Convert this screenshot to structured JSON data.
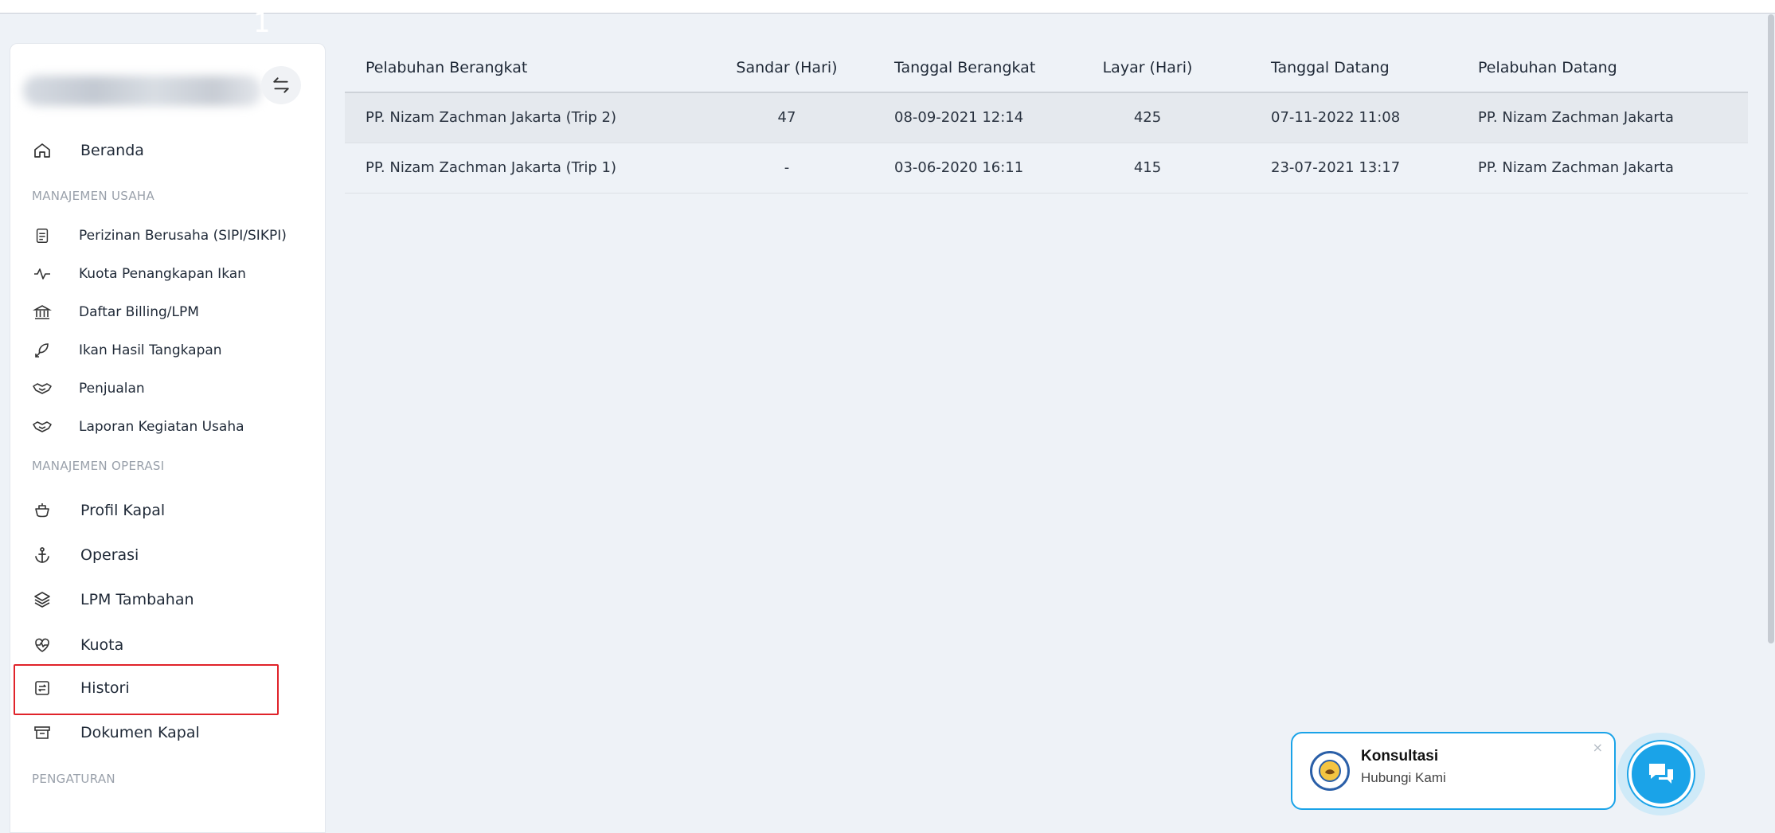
{
  "page_number_marker": "1",
  "sidebar": {
    "items": [
      {
        "key": "beranda",
        "label": "Beranda",
        "icon": "home-icon"
      },
      {
        "key": "perizinan",
        "label": "Perizinan Berusaha (SIPI/SIKPI)",
        "icon": "document-icon"
      },
      {
        "key": "kuota-penangkapan",
        "label": "Kuota Penangkapan Ikan",
        "icon": "pulse-icon"
      },
      {
        "key": "billing",
        "label": "Daftar Billing/LPM",
        "icon": "bank-icon"
      },
      {
        "key": "ikan-hasil",
        "label": "Ikan Hasil Tangkapan",
        "icon": "fish-icon"
      },
      {
        "key": "penjualan",
        "label": "Penjualan",
        "icon": "handshake-icon"
      },
      {
        "key": "laporan",
        "label": "Laporan Kegiatan Usaha",
        "icon": "handshake-icon"
      },
      {
        "key": "profil-kapal",
        "label": "Profil Kapal",
        "icon": "ship-icon"
      },
      {
        "key": "operasi",
        "label": "Operasi",
        "icon": "anchor-icon"
      },
      {
        "key": "lpm-tambahan",
        "label": "LPM Tambahan",
        "icon": "layers-icon"
      },
      {
        "key": "kuota",
        "label": "Kuota",
        "icon": "heart-pulse-icon"
      },
      {
        "key": "histori",
        "label": "Histori",
        "icon": "history-icon"
      },
      {
        "key": "dokumen-kapal",
        "label": "Dokumen Kapal",
        "icon": "archive-icon"
      }
    ],
    "sections": {
      "usaha": "MANAJEMEN USAHA",
      "operasi": "MANAJEMEN OPERASI",
      "pengaturan": "PENGATURAN"
    },
    "active_item": "Histori"
  },
  "table": {
    "headers": [
      "Pelabuhan Berangkat",
      "Sandar (Hari)",
      "Tanggal Berangkat",
      "Layar (Hari)",
      "Tanggal Datang",
      "Pelabuhan Datang"
    ],
    "rows": [
      [
        "PP. Nizam Zachman Jakarta (Trip 2)",
        "47",
        "08-09-2021 12:14",
        "425",
        "07-11-2022 11:08",
        "PP. Nizam Zachman Jakarta"
      ],
      [
        "PP. Nizam Zachman Jakarta (Trip 1)",
        "-",
        "03-06-2020 16:11",
        "415",
        "23-07-2021 13:17",
        "PP. Nizam Zachman Jakarta"
      ]
    ]
  },
  "consult": {
    "title": "Konsultasi",
    "subtitle": "Hubungi Kami",
    "close": "×"
  },
  "colors": {
    "accent": "#1aa3e8",
    "highlight": "#e0232a",
    "background": "#eef2f7"
  }
}
